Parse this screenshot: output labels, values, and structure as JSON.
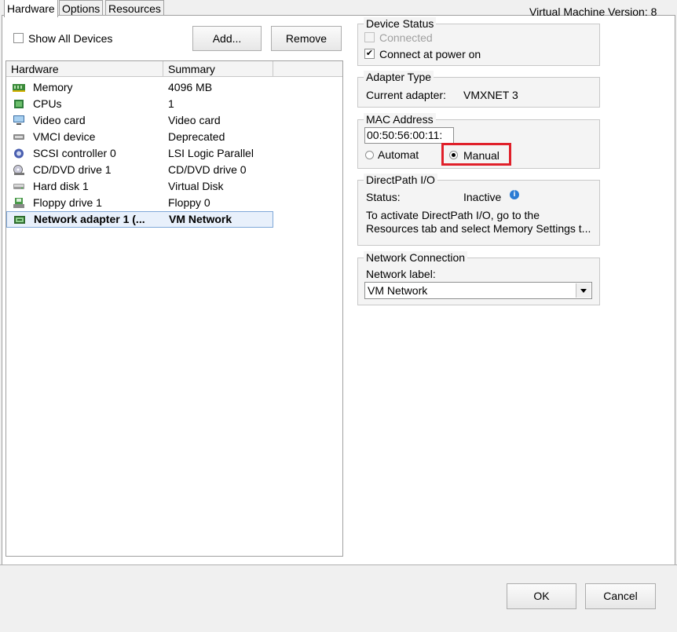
{
  "tabs": [
    {
      "label": "Hardware",
      "active": true
    },
    {
      "label": "Options",
      "active": false
    },
    {
      "label": "Resources",
      "active": false
    }
  ],
  "vm_version": "Virtual Machine Version: 8",
  "toolbar": {
    "show_all_devices": "Show All Devices",
    "show_all_devices_checked": false,
    "add_label": "Add...",
    "remove_label": "Remove"
  },
  "hardware_list": {
    "col_hardware": "Hardware",
    "col_summary": "Summary",
    "rows": [
      {
        "name": "Memory",
        "summary": "4096 MB",
        "icon": "memory-icon"
      },
      {
        "name": "CPUs",
        "summary": "1",
        "icon": "cpu-icon"
      },
      {
        "name": "Video card",
        "summary": "Video card",
        "icon": "monitor-icon"
      },
      {
        "name": "VMCI device",
        "summary": "Deprecated",
        "icon": "vmci-icon"
      },
      {
        "name": "SCSI controller 0",
        "summary": "LSI Logic Parallel",
        "icon": "scsi-icon"
      },
      {
        "name": "CD/DVD drive 1",
        "summary": "CD/DVD drive 0",
        "icon": "cd-dvd-icon"
      },
      {
        "name": "Hard disk 1",
        "summary": "Virtual Disk",
        "icon": "hard-disk-icon"
      },
      {
        "name": "Floppy drive 1",
        "summary": "Floppy 0",
        "icon": "floppy-icon"
      },
      {
        "name": "Network adapter 1 (...",
        "summary": "VM Network",
        "icon": "network-adapter-icon",
        "selected": true
      }
    ]
  },
  "device_status": {
    "title": "Device Status",
    "connected": "Connected",
    "connected_checked": false,
    "connect_at_power_on": "Connect at power on",
    "connect_at_power_on_checked": true
  },
  "adapter_type": {
    "title": "Adapter Type",
    "label": "Current adapter:",
    "value": "VMXNET 3"
  },
  "mac_address": {
    "title": "MAC Address",
    "value": "00:50:56:00:11:",
    "automatic_label": "Automat",
    "manual_label": "Manual",
    "selected": "manual"
  },
  "directpath": {
    "title": "DirectPath I/O",
    "status_label": "Status:",
    "status_value": "Inactive",
    "info_line1": "To activate DirectPath I/O, go to the",
    "info_line2": "Resources tab and select Memory Settings t..."
  },
  "network_connection": {
    "title": "Network Connection",
    "network_label": "Network label:",
    "selected": "VM Network"
  },
  "footer": {
    "ok_label": "OK",
    "cancel_label": "Cancel"
  },
  "colors": {
    "highlight_box": "#e0202a",
    "selection_bg": "#e8f0fb",
    "info_icon": "#2a7bd4"
  }
}
